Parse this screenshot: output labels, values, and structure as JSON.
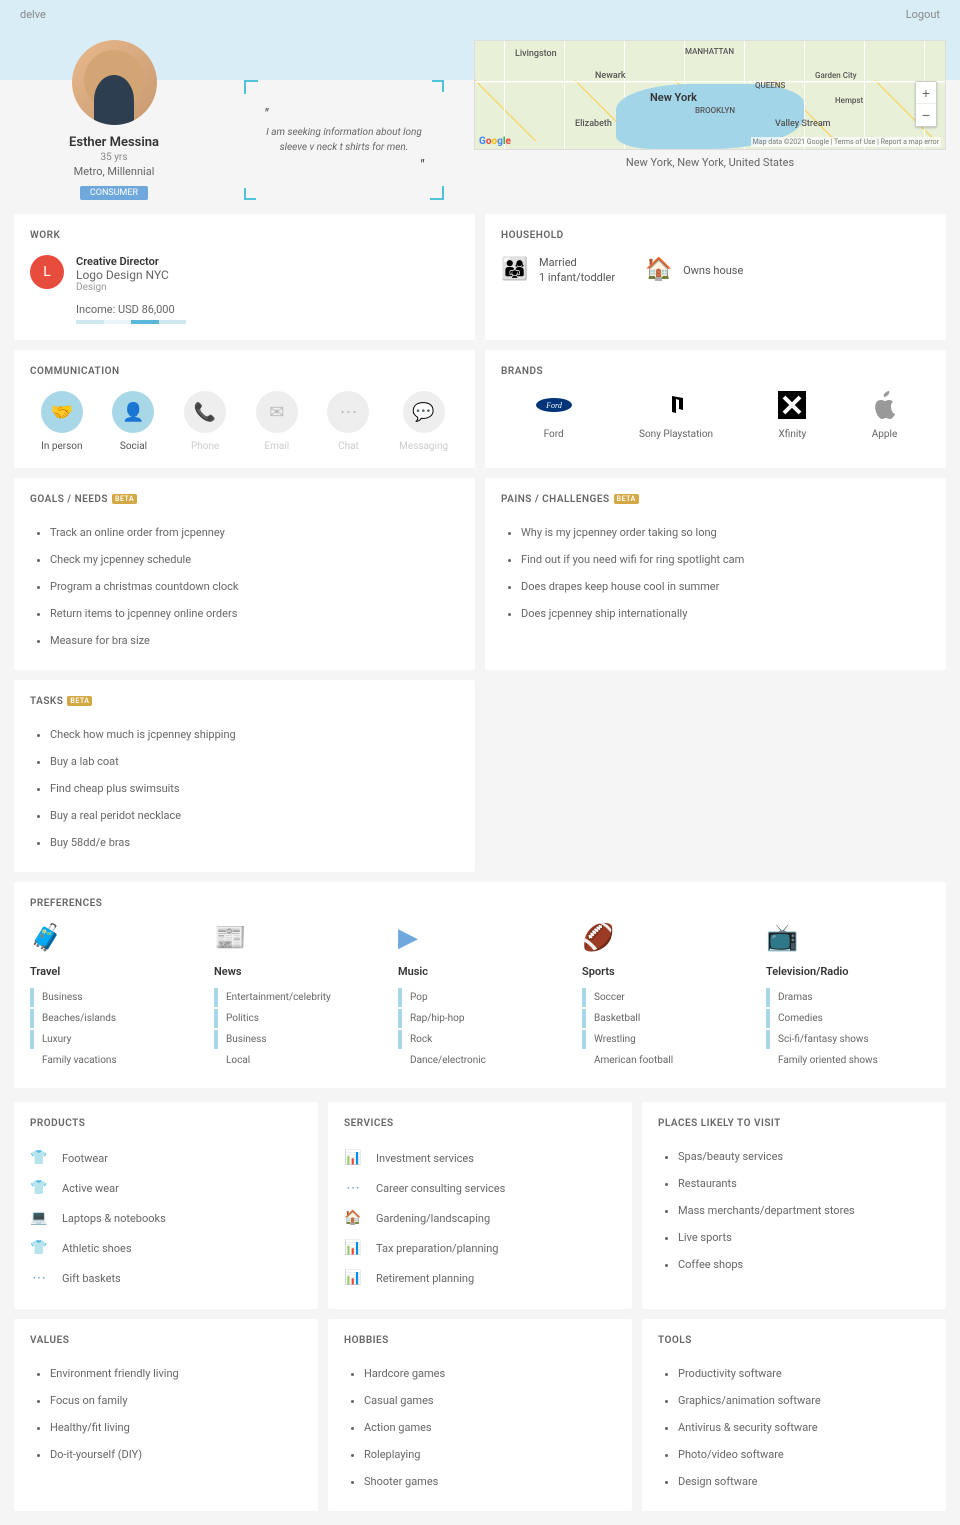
{
  "header": {
    "left": "delve",
    "right": "Logout"
  },
  "profile": {
    "name": "Esther Messina",
    "age": "35 yrs",
    "meta": "Metro, Millennial",
    "badge": "CONSUMER"
  },
  "quote": "I am seeking information about long sleeve v neck t shirts for men.",
  "map": {
    "caption": "New York, New York, United States",
    "labels": [
      "Livingston",
      "Newark",
      "MANHATTAN",
      "New York",
      "BROOKLYN",
      "Elizabeth",
      "QUEENS",
      "Valley Stream",
      "Garden City",
      "Hempst"
    ],
    "attribution": "Map data ©2021 Google | Terms of Use | Report a map error",
    "logo": "Google"
  },
  "work": {
    "title": "WORK",
    "initial": "L",
    "role": "Creative Director",
    "company": "Logo Design NYC",
    "dept": "Design",
    "income_label": "Income: USD 86,000"
  },
  "household": {
    "title": "HOUSEHOLD",
    "status1": "Married",
    "status2": "1 infant/toddler",
    "home": "Owns house"
  },
  "communication": {
    "title": "COMMUNICATION",
    "items": [
      {
        "label": "In person",
        "active": true,
        "icon": "handshake"
      },
      {
        "label": "Social",
        "active": true,
        "icon": "person"
      },
      {
        "label": "Phone",
        "active": false,
        "icon": "phone"
      },
      {
        "label": "Email",
        "active": false,
        "icon": "mail"
      },
      {
        "label": "Chat",
        "active": false,
        "icon": "dots"
      },
      {
        "label": "Messaging",
        "active": false,
        "icon": "msg"
      }
    ]
  },
  "brands": {
    "title": "BRANDS",
    "items": [
      {
        "label": "Ford"
      },
      {
        "label": "Sony Playstation"
      },
      {
        "label": "Xfinity"
      },
      {
        "label": "Apple"
      }
    ]
  },
  "goals": {
    "title": "GOALS / NEEDS",
    "items": [
      "Track an online order from jcpenney",
      "Check my jcpenney schedule",
      "Program a christmas countdown clock",
      "Return items to jcpenney online orders",
      "Measure for bra size"
    ]
  },
  "pains": {
    "title": "PAINS / CHALLENGES",
    "items": [
      "Why is my jcpenney order taking so long",
      "Find out if you need wifi for ring spotlight cam",
      "Does drapes keep house cool in summer",
      "Does jcpenney ship internationally"
    ]
  },
  "tasks": {
    "title": "TASKS",
    "items": [
      "Check how much is jcpenney shipping",
      "Buy a lab coat",
      "Find cheap plus swimsuits",
      "Buy a real peridot necklace",
      "Buy 58dd/e bras"
    ]
  },
  "preferences": {
    "title": "PREFERENCES",
    "cols": [
      {
        "title": "Travel",
        "icon": "luggage",
        "items": [
          {
            "t": "Business",
            "hl": true
          },
          {
            "t": "Beaches/islands",
            "hl": true
          },
          {
            "t": "Luxury",
            "hl": true
          },
          {
            "t": "Family vacations",
            "hl": false
          }
        ]
      },
      {
        "title": "News",
        "icon": "news",
        "items": [
          {
            "t": "Entertainment/celebrity",
            "hl": true
          },
          {
            "t": "Politics",
            "hl": true
          },
          {
            "t": "Business",
            "hl": true
          },
          {
            "t": "Local",
            "hl": false
          }
        ]
      },
      {
        "title": "Music",
        "icon": "music",
        "items": [
          {
            "t": "Pop",
            "hl": true
          },
          {
            "t": "Rap/hip-hop",
            "hl": true
          },
          {
            "t": "Rock",
            "hl": true
          },
          {
            "t": "Dance/electronic",
            "hl": false
          }
        ]
      },
      {
        "title": "Sports",
        "icon": "sports",
        "items": [
          {
            "t": "Soccer",
            "hl": true
          },
          {
            "t": "Basketball",
            "hl": true
          },
          {
            "t": "Wrestling",
            "hl": true
          },
          {
            "t": "American football",
            "hl": false
          }
        ]
      },
      {
        "title": "Television/Radio",
        "icon": "tv",
        "items": [
          {
            "t": "Dramas",
            "hl": true
          },
          {
            "t": "Comedies",
            "hl": true
          },
          {
            "t": "Sci-fi/fantasy shows",
            "hl": true
          },
          {
            "t": "Family oriented shows",
            "hl": false
          }
        ]
      }
    ]
  },
  "products": {
    "title": "PRODUCTS",
    "items": [
      "Footwear",
      "Active wear",
      "Laptops & notebooks",
      "Athletic shoes",
      "Gift baskets"
    ]
  },
  "services": {
    "title": "SERVICES",
    "items": [
      "Investment services",
      "Career consulting services",
      "Gardening/landscaping",
      "Tax preparation/planning",
      "Retirement planning"
    ]
  },
  "places": {
    "title": "PLACES LIKELY TO VISIT",
    "items": [
      "Spas/beauty services",
      "Restaurants",
      "Mass merchants/department stores",
      "Live sports",
      "Coffee shops"
    ]
  },
  "values": {
    "title": "VALUES",
    "items": [
      "Environment friendly living",
      "Focus on family",
      "Healthy/fit living",
      "Do-it-yourself (DIY)"
    ]
  },
  "hobbies": {
    "title": "HOBBIES",
    "items": [
      "Hardcore games",
      "Casual games",
      "Action games",
      "Roleplaying",
      "Shooter games"
    ]
  },
  "tools": {
    "title": "TOOLS",
    "items": [
      "Productivity software",
      "Graphics/animation software",
      "Antivirus & security software",
      "Photo/video software",
      "Design software"
    ]
  }
}
